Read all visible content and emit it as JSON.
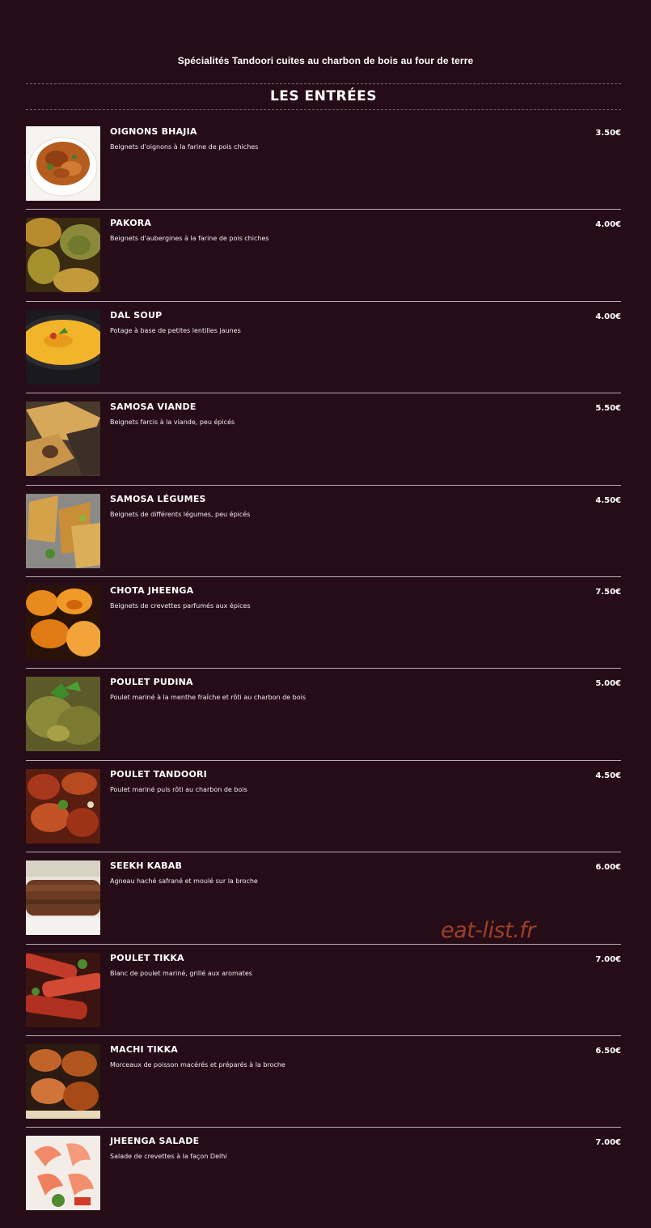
{
  "page": {
    "subtitle": "Spécialités Tandoori cuites au charbon de bois au four de terre",
    "section_title": "LES ENTRÉES",
    "watermark": "eat-list.fr"
  },
  "items": [
    {
      "name": "OIGNONS BHAJIA",
      "desc": "Beignets d'oignons à la farine de pois chiches",
      "price": "3.50€",
      "image": "onion-bhaji-photo"
    },
    {
      "name": "PAKORA",
      "desc": "Beignets d'aubergines à la farine de pois chiches",
      "price": "4.00€",
      "image": "pakora-photo"
    },
    {
      "name": "DAL SOUP",
      "desc": "Potage à base de petites lentilles jaunes",
      "price": "4.00€",
      "image": "dal-soup-photo"
    },
    {
      "name": "SAMOSA VIANDE",
      "desc": "Beignets farcis à la viande, peu épicés",
      "price": "5.50€",
      "image": "meat-samosa-photo"
    },
    {
      "name": "SAMOSA LÉGUMES",
      "desc": "Beignets de différents légumes, peu épicés",
      "price": "4.50€",
      "image": "veg-samosa-photo"
    },
    {
      "name": "CHOTA JHEENGA",
      "desc": "Beignets de crevettes parfumés aux épices",
      "price": "7.50€",
      "image": "prawn-fritters-photo"
    },
    {
      "name": "POULET PUDINA",
      "desc": "Poulet mariné à la menthe fraîche et rôti au charbon de bois",
      "price": "5.00€",
      "image": "mint-chicken-photo"
    },
    {
      "name": "POULET TANDOORI",
      "desc": "Poulet mariné puis rôti au charbon de bois",
      "price": "4.50€",
      "image": "tandoori-chicken-photo"
    },
    {
      "name": "SEEKH KABAB",
      "desc": "Agneau haché safrané et moulé sur la broche",
      "price": "6.00€",
      "image": "seekh-kabab-photo"
    },
    {
      "name": "POULET TIKKA",
      "desc": "Blanc de poulet mariné, grillé aux aromates",
      "price": "7.00€",
      "image": "chicken-tikka-photo"
    },
    {
      "name": "MACHI TIKKA",
      "desc": "Morceaux de poisson macérés et préparés à la broche",
      "price": "6.50€",
      "image": "fish-tikka-photo"
    },
    {
      "name": "JHEENGA SALADE",
      "desc": "Salade de crevettes à la façon Delhi",
      "price": "7.00€",
      "image": "prawn-salad-photo"
    }
  ]
}
